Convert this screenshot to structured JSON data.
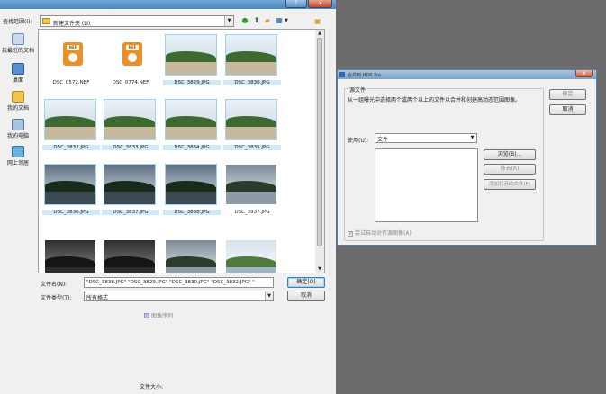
{
  "open_dialog": {
    "titlebar": {
      "help": "?",
      "close": "x"
    },
    "look_in_label": "查找范围(I):",
    "look_in_value": "新建文件夹 (D)",
    "places": [
      "我最近的文档",
      "桌面",
      "我的文档",
      "我的电脑",
      "网上邻居"
    ],
    "files": [
      {
        "name": "DSC_0572.NEF",
        "kind": "nef",
        "selected": false
      },
      {
        "name": "DSC_0774.NEF",
        "kind": "nef",
        "selected": false
      },
      {
        "name": "DSC_3829.JPG",
        "kind": "day",
        "selected": true
      },
      {
        "name": "DSC_3830.JPG",
        "kind": "day",
        "selected": true
      },
      {
        "name": "DSC_3832.JPG",
        "kind": "day",
        "selected": true
      },
      {
        "name": "DSC_3833.JPG",
        "kind": "day",
        "selected": true
      },
      {
        "name": "DSC_3834.JPG",
        "kind": "day",
        "selected": true
      },
      {
        "name": "DSC_3835.JPG",
        "kind": "day",
        "selected": true
      },
      {
        "name": "DSC_3836.JPG",
        "kind": "dusk",
        "selected": true
      },
      {
        "name": "DSC_3837.JPG",
        "kind": "dusk",
        "selected": true
      },
      {
        "name": "DSC_3838.JPG",
        "kind": "dusk",
        "selected": true
      },
      {
        "name": "DSC_3937.JPG",
        "kind": "lake",
        "selected": false
      },
      {
        "name": "",
        "kind": "night",
        "selected": false
      },
      {
        "name": "",
        "kind": "night",
        "selected": false
      },
      {
        "name": "",
        "kind": "lake",
        "selected": false
      },
      {
        "name": "",
        "kind": "lakeday",
        "selected": false
      }
    ],
    "filename_label": "文件名(N):",
    "filename_value": "\"DSC_3838.JPG\" \"DSC_3829.JPG\" \"DSC_3830.JPG\" \"DSC_3832.JPG\" \"",
    "filetype_label": "文件类型(T):",
    "filetype_value": "所有格式",
    "open_button": "确定(O)",
    "cancel_button": "取消",
    "image_sequence": "图像序列",
    "file_size_label": "文件大小:"
  },
  "merge_dialog": {
    "title": "合并到 HDR Pro",
    "close": "x",
    "source_group_label": "源文件",
    "description": "从一组曝光中选择两个或两个以上的文件以合并和创建高动态范围图像。",
    "use_label": "使用(U):",
    "use_value": "文件",
    "browse_button": "浏览(B)...",
    "remove_button": "移去(R)",
    "add_open_button": "添加打开的文件(F)",
    "align_checkbox": "尝试自动对齐源图像(A)",
    "ok_button": "确定",
    "cancel_button": "取消"
  },
  "colors": {
    "desktop": "#6b6b6b",
    "dialog": "#f0f0f0",
    "selection": "#cfe9f8"
  }
}
